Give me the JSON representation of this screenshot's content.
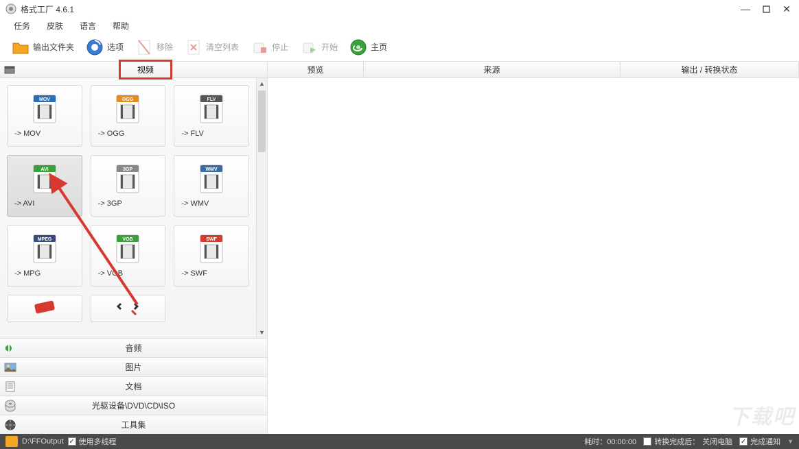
{
  "window": {
    "title": "格式工厂 4.6.1"
  },
  "menu": {
    "items": [
      "任务",
      "皮肤",
      "语言",
      "帮助"
    ]
  },
  "toolbar": {
    "output_folder": "输出文件夹",
    "options": "选项",
    "remove": "移除",
    "clear_list": "清空列表",
    "stop": "停止",
    "start": "开始",
    "home": "主页"
  },
  "left_panel": {
    "active_category": "视频",
    "formats": [
      {
        "label": "-> MOV",
        "badge": "MOV",
        "badge_color": "#2b6db5",
        "selected": false
      },
      {
        "label": "-> OGG",
        "badge": "OGG",
        "badge_color": "#e88b1a",
        "selected": false
      },
      {
        "label": "-> FLV",
        "badge": "FLV",
        "badge_color": "#555555",
        "selected": false
      },
      {
        "label": "-> AVI",
        "badge": "AVI",
        "badge_color": "#3aa03a",
        "selected": true
      },
      {
        "label": "-> 3GP",
        "badge": "3GP",
        "badge_color": "#888888",
        "selected": false
      },
      {
        "label": "-> WMV",
        "badge": "WMV",
        "badge_color": "#3a6aa0",
        "selected": false
      },
      {
        "label": "-> MPG",
        "badge": "MPEG",
        "badge_color": "#3a4a7a",
        "selected": false
      },
      {
        "label": "-> VOB",
        "badge": "VOB",
        "badge_color": "#3aa03a",
        "selected": false
      },
      {
        "label": "-> SWF",
        "badge": "SWF",
        "badge_color": "#d63a2f",
        "selected": false
      }
    ],
    "categories": [
      "音频",
      "图片",
      "文档",
      "光驱设备\\DVD\\CD\\ISO",
      "工具集"
    ]
  },
  "table": {
    "columns": [
      "预览",
      "来源",
      "输出 / 转换状态"
    ]
  },
  "statusbar": {
    "output_path": "D:\\FFOutput",
    "multithread_label": "使用多线程",
    "multithread_checked": true,
    "elapsed_label": "耗时：",
    "elapsed_value": "00:00:00",
    "after_convert_label": "转换完成后：",
    "after_convert_value": "关闭电脑",
    "after_convert_checked": false,
    "notify_label": "完成通知",
    "notify_checked": true
  },
  "watermark": "下载吧"
}
